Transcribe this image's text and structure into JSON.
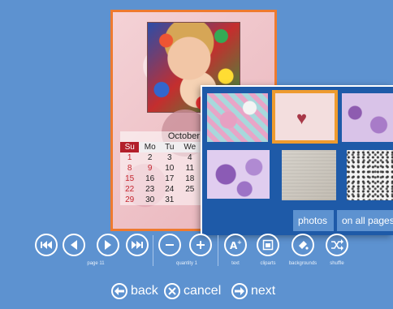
{
  "calendar": {
    "month": "October",
    "weekdays": [
      "Su",
      "Mo",
      "Tu",
      "We"
    ],
    "rows": [
      [
        "1",
        "2",
        "3",
        "4"
      ],
      [
        "8",
        "9",
        "10",
        "11"
      ],
      [
        "15",
        "16",
        "17",
        "18"
      ],
      [
        "22",
        "23",
        "24",
        "25"
      ],
      [
        "29",
        "30",
        "31",
        ""
      ]
    ]
  },
  "picker": {
    "tabs": [
      "photos",
      "on all pages"
    ]
  },
  "toolbar": {
    "page_label": "page 11",
    "quantity_label": "quantity 1",
    "text_label": "text",
    "cliparts_label": "cliparts",
    "backgrounds_label": "backgrounds",
    "shuffle_label": "shuffle"
  },
  "nav": {
    "back": "back",
    "cancel": "cancel",
    "next": "next"
  },
  "colors": {
    "background": "#5d92d0",
    "selected_border": "#ee7a2f",
    "picker_panel": "#1e5aa8"
  }
}
